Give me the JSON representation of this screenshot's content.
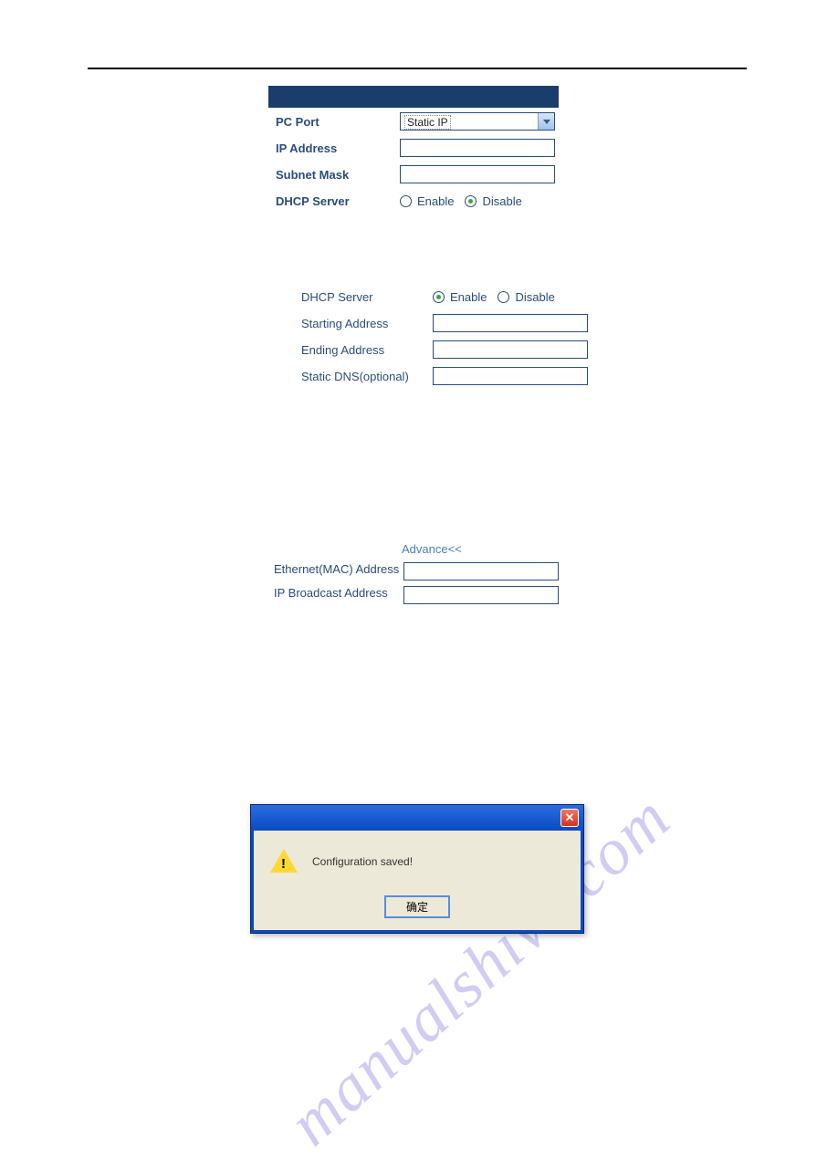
{
  "watermark": "manualshive.com",
  "section1": {
    "pc_port_label": "PC Port",
    "pc_port_value": "Static IP",
    "ip_address_label": "IP Address",
    "ip_address_value": "",
    "subnet_mask_label": "Subnet Mask",
    "subnet_mask_value": "",
    "dhcp_server_label": "DHCP Server",
    "enable_label": "Enable",
    "disable_label": "Disable",
    "dhcp_selected": "disable"
  },
  "section2": {
    "dhcp_server_label": "DHCP Server",
    "enable_label": "Enable",
    "disable_label": "Disable",
    "dhcp_selected": "enable",
    "starting_address_label": "Starting Address",
    "starting_address_value": "",
    "ending_address_label": "Ending Address",
    "ending_address_value": "",
    "static_dns_label": "Static DNS(optional)",
    "static_dns_value": ""
  },
  "advance": {
    "link_text": "Advance<<",
    "ethernet_mac_label": "Ethernet(MAC) Address",
    "ethernet_mac_value": "",
    "ip_broadcast_label": "IP Broadcast Address",
    "ip_broadcast_value": ""
  },
  "dialog": {
    "message": "Configuration saved!",
    "button_label": "确定"
  }
}
